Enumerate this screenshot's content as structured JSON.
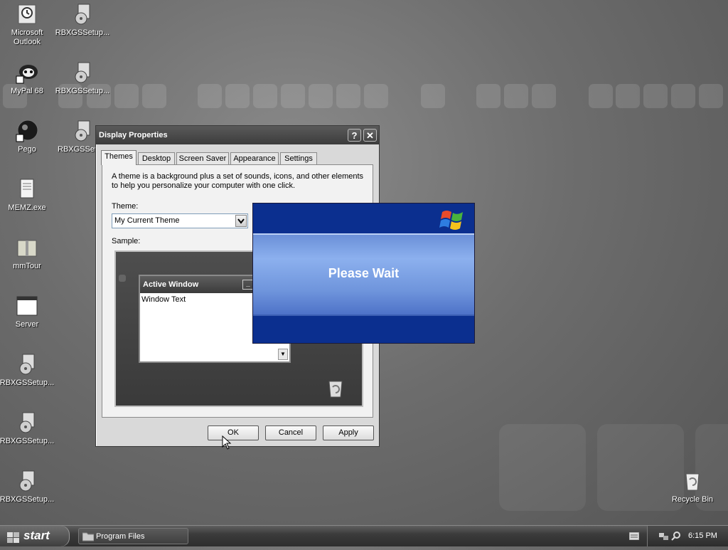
{
  "desktop": {
    "icons": [
      {
        "label": "Microsoft\nOutlook"
      },
      {
        "label": "RBXGSSetup..."
      },
      {
        "label": "MyPal 68"
      },
      {
        "label": "RBXGSSetup..."
      },
      {
        "label": "Pego"
      },
      {
        "label": "RBXGSSetup..."
      },
      {
        "label": "MEMZ.exe"
      },
      {
        "label": "mmTour"
      },
      {
        "label": "Server"
      },
      {
        "label": "RBXGSSetup..."
      },
      {
        "label": "RBXGSSetup..."
      },
      {
        "label": "RBXGSSetup..."
      },
      {
        "label": "Recycle Bin"
      }
    ]
  },
  "dialog": {
    "title": "Display Properties",
    "help_label": "?",
    "close_label": "✕",
    "tabs": [
      "Themes",
      "Desktop",
      "Screen Saver",
      "Appearance",
      "Settings"
    ],
    "description": "A theme is a background plus a set of sounds, icons, and other elements to help you personalize your computer with one click.",
    "theme_label": "Theme:",
    "theme_value": "My Current Theme",
    "sample_label": "Sample:",
    "sample": {
      "window_title": "Active Window",
      "window_text": "Window Text"
    },
    "buttons": {
      "ok": "OK",
      "cancel": "Cancel",
      "apply": "Apply"
    }
  },
  "wait_splash": {
    "message": "Please Wait"
  },
  "taskbar": {
    "start_label": "start",
    "tasks": [
      {
        "label": "Program Files"
      }
    ],
    "clock": "6:15 PM"
  },
  "colors": {
    "splash_blue": "#0b2f8f",
    "splash_band": "#8cb0ee",
    "titlebar": "#3c3c3c"
  }
}
